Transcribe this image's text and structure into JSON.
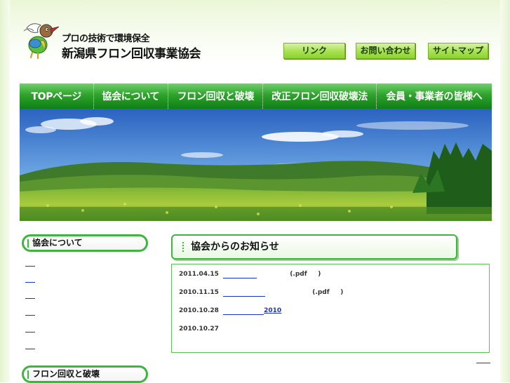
{
  "header": {
    "tagline": "プロの技術で環境保全",
    "site_name": "新潟県フロン回収事業協会"
  },
  "top_buttons": [
    {
      "label": "リンク"
    },
    {
      "label": "お問い合わせ"
    },
    {
      "label": "サイトマップ"
    }
  ],
  "nav": [
    {
      "label": "TOPページ"
    },
    {
      "label": "協会について"
    },
    {
      "label": "フロン回収と破壊"
    },
    {
      "label": "改正フロン回収破壊法"
    },
    {
      "label": "会員・事業者の皆様へ"
    }
  ],
  "sidebar": {
    "section1_title": "協会について",
    "section1_links": 6,
    "section2_title": "フロン回収と破壊"
  },
  "main": {
    "news_title": "協会からのお知らせ",
    "news": [
      {
        "date": "2011.04.15",
        "link_suffix": "",
        "ext": "(.pdf     )"
      },
      {
        "date": "2010.11.15",
        "link_suffix": "",
        "ext": "(.pdf     )"
      },
      {
        "date": "2010.10.28",
        "link_suffix": "2010",
        "ext": ""
      },
      {
        "date": "2010.10.27",
        "link_suffix": "",
        "ext": ""
      }
    ]
  },
  "colors": {
    "nav_green": "#2ea32c",
    "button_green": "#a7e04e",
    "border_green": "#3fb43f",
    "link_blue": "#1a33cc"
  }
}
